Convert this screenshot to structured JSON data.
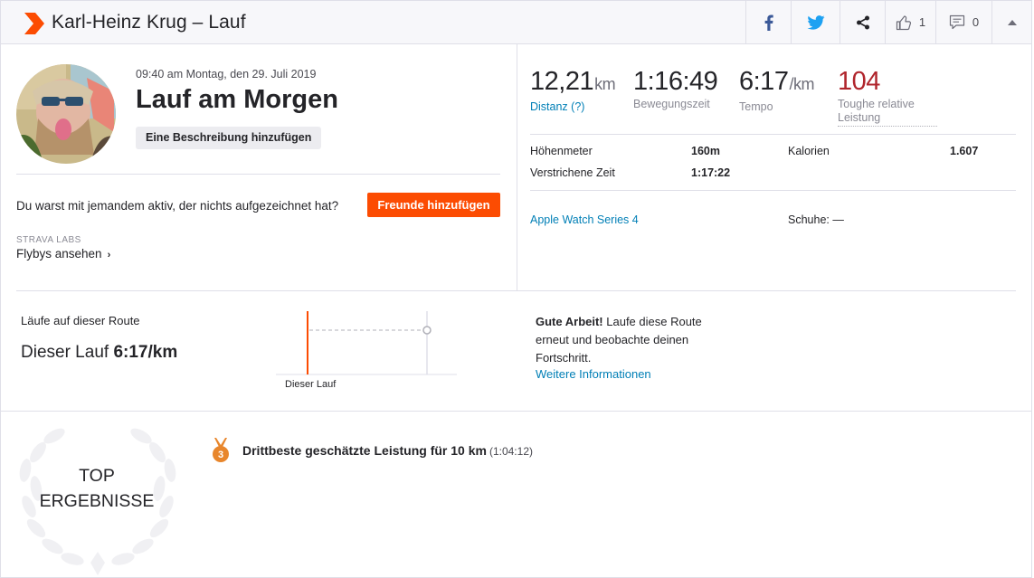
{
  "header": {
    "title": "Karl-Heinz Krug – Lauf",
    "kudos_count": "1",
    "comment_count": "0"
  },
  "activity": {
    "datetime": "09:40 am Montag, den 29. Juli 2019",
    "title": "Lauf am Morgen",
    "add_description": "Eine Beschreibung hinzufügen",
    "friends_prompt": "Du warst mit jemandem aktiv, der nichts aufgezeichnet hat?",
    "friends_button": "Freunde hinzufügen",
    "labs_label": "STRAVA LABS",
    "flybys_link": "Flybys ansehen"
  },
  "stats": {
    "distance": {
      "value": "12,21",
      "unit": "km",
      "label": "Distanz (?)"
    },
    "moving_time": {
      "value": "1:16:49",
      "label": "Bewegungszeit"
    },
    "pace": {
      "value": "6:17",
      "unit": "/km",
      "label": "Tempo"
    },
    "relative_effort": {
      "value": "104",
      "label": "Toughe relative Leistung"
    }
  },
  "details": {
    "elevation_label": "Höhenmeter",
    "elevation_value": "160m",
    "calories_label": "Kalorien",
    "calories_value": "1.607",
    "elapsed_label": "Verstrichene Zeit",
    "elapsed_value": "1:17:22",
    "device": "Apple Watch Series 4",
    "shoes_label": "Schuhe: —"
  },
  "route": {
    "heading": "Läufe auf dieser Route",
    "this_run_label": "Dieser Lauf",
    "this_run_value": "6:17/km",
    "chart_label": "Dieser Lauf",
    "message_bold": "Gute Arbeit!",
    "message_rest": " Laufe diese Route erneut und beobachte deinen Fortschritt.",
    "more_info": "Weitere Informationen"
  },
  "top_results": {
    "badge_line1": "TOP",
    "badge_line2": "ERGEBNISSE",
    "medal_rank": "3",
    "result_text": "Drittbeste geschätzte Leistung für 10 km",
    "result_time": "(1:04:12)"
  },
  "colors": {
    "brand": "#fc4c02",
    "link": "#007fb6",
    "relative_effort": "#b0252c"
  }
}
